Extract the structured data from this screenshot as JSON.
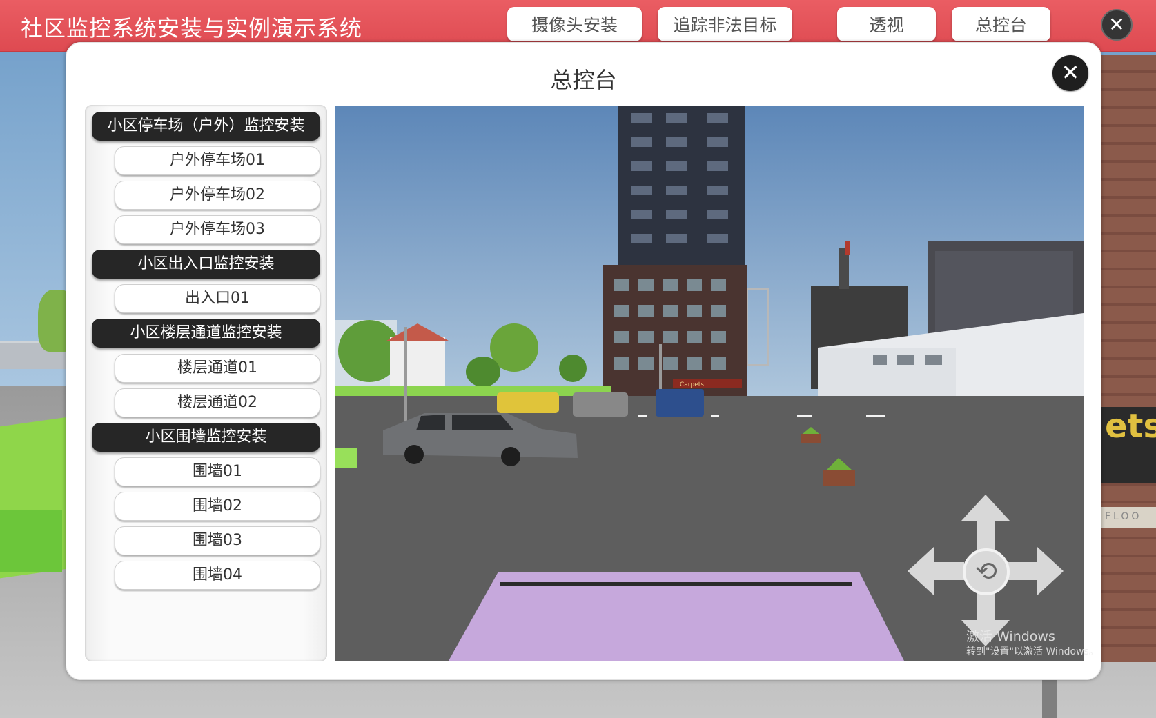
{
  "app": {
    "title": "社区监控系统安装与实例演示系统"
  },
  "top_nav": {
    "buttons": [
      {
        "label": "摄像头安装"
      },
      {
        "label": "追踪非法目标"
      },
      {
        "label": "透视"
      },
      {
        "label": "总控台"
      }
    ],
    "close_icon": "close-icon"
  },
  "panel": {
    "title": "总控台",
    "close_icon": "close-icon"
  },
  "sidebar": {
    "groups": [
      {
        "header": "小区停车场（户外）监控安装",
        "items": [
          "户外停车场01",
          "户外停车场02",
          "户外停车场03"
        ]
      },
      {
        "header": "小区出入口监控安装",
        "items": [
          "出入口01"
        ]
      },
      {
        "header": "小区楼层通道监控安装",
        "items": [
          "楼层通道01",
          "楼层通道02"
        ]
      },
      {
        "header": "小区围墙监控安装",
        "items": [
          "围墙01",
          "围墙02",
          "围墙03",
          "围墙04"
        ]
      }
    ]
  },
  "camera_view": {
    "storefront_sign": "Carpets",
    "controls": {
      "up": "arrow-up-icon",
      "down": "arrow-down-icon",
      "left": "arrow-left-icon",
      "right": "arrow-right-icon",
      "center": "rotate-icon"
    }
  },
  "background": {
    "sign_text": "ets",
    "floor_text": "FLOO"
  },
  "watermark": {
    "line1": "激活 Windows",
    "line2": "转到\"设置\"以激活 Windows。"
  },
  "colors": {
    "header_red": "#e2525a",
    "group_header_bg": "#262626",
    "panel_bg": "#ffffff"
  }
}
